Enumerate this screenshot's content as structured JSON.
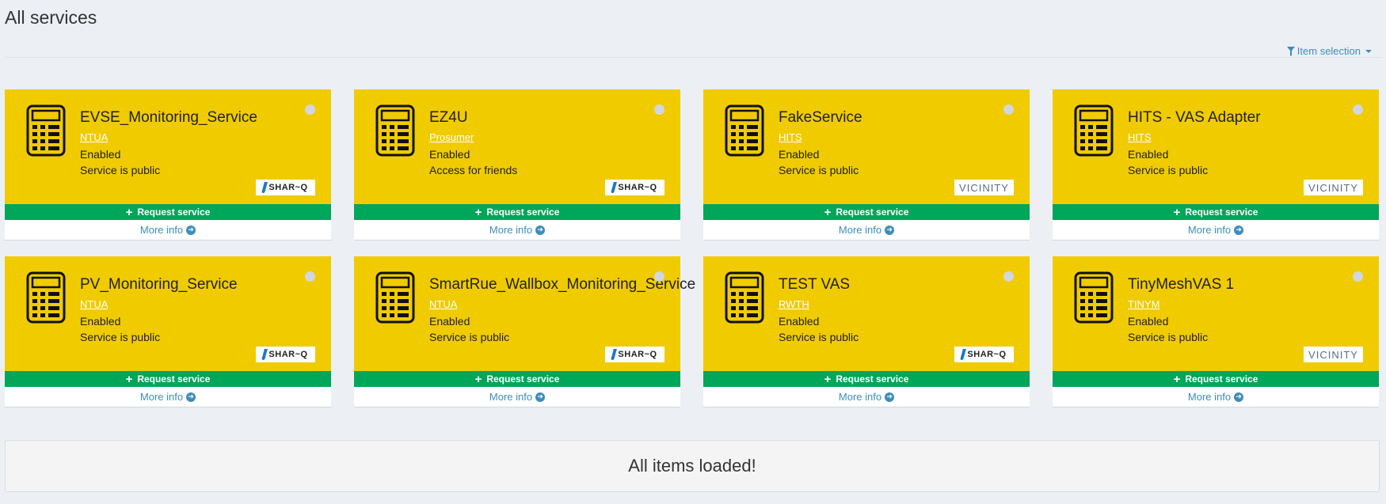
{
  "page": {
    "title": "All services",
    "filter_label": "Item selection"
  },
  "colors": {
    "card_bg": "#f0cb00",
    "request_button": "#00a65a",
    "link": "#3c8dbc"
  },
  "cards": [
    {
      "name": "EVSE_Monitoring_Service",
      "org": "NTUA",
      "status": "Enabled",
      "access": "Service is public",
      "logo": "SHAR~Q",
      "logo_type": "sharq",
      "request_label": "Request service",
      "more_label": "More info"
    },
    {
      "name": "EZ4U",
      "org": "Prosumer",
      "status": "Enabled",
      "access": "Access for friends",
      "logo": "SHAR~Q",
      "logo_type": "sharq",
      "request_label": "Request service",
      "more_label": "More info"
    },
    {
      "name": "FakeService",
      "org": "HITS",
      "status": "Enabled",
      "access": "Service is public",
      "logo": "VICINITY",
      "logo_type": "vicinity",
      "request_label": "Request service",
      "more_label": "More info"
    },
    {
      "name": "HITS - VAS Adapter",
      "org": "HITS",
      "status": "Enabled",
      "access": "Service is public",
      "logo": "VICINITY",
      "logo_type": "vicinity",
      "request_label": "Request service",
      "more_label": "More info"
    },
    {
      "name": "PV_Monitoring_Service",
      "org": "NTUA",
      "status": "Enabled",
      "access": "Service is public",
      "logo": "SHAR~Q",
      "logo_type": "sharq",
      "request_label": "Request service",
      "more_label": "More info"
    },
    {
      "name": "SmartRue_Wallbox_Monitoring_Service",
      "org": "NTUA",
      "status": "Enabled",
      "access": "Service is public",
      "logo": "SHAR~Q",
      "logo_type": "sharq",
      "request_label": "Request service",
      "more_label": "More info"
    },
    {
      "name": "TEST VAS",
      "org": "RWTH",
      "status": "Enabled",
      "access": "Service is public",
      "logo": "SHAR~Q",
      "logo_type": "sharq",
      "request_label": "Request service",
      "more_label": "More info"
    },
    {
      "name": "TinyMeshVAS 1",
      "org": "TINYM",
      "status": "Enabled",
      "access": "Service is public",
      "logo": "VICINITY",
      "logo_type": "vicinity",
      "request_label": "Request service",
      "more_label": "More info"
    }
  ],
  "footer": {
    "loaded_message": "All items loaded!"
  }
}
